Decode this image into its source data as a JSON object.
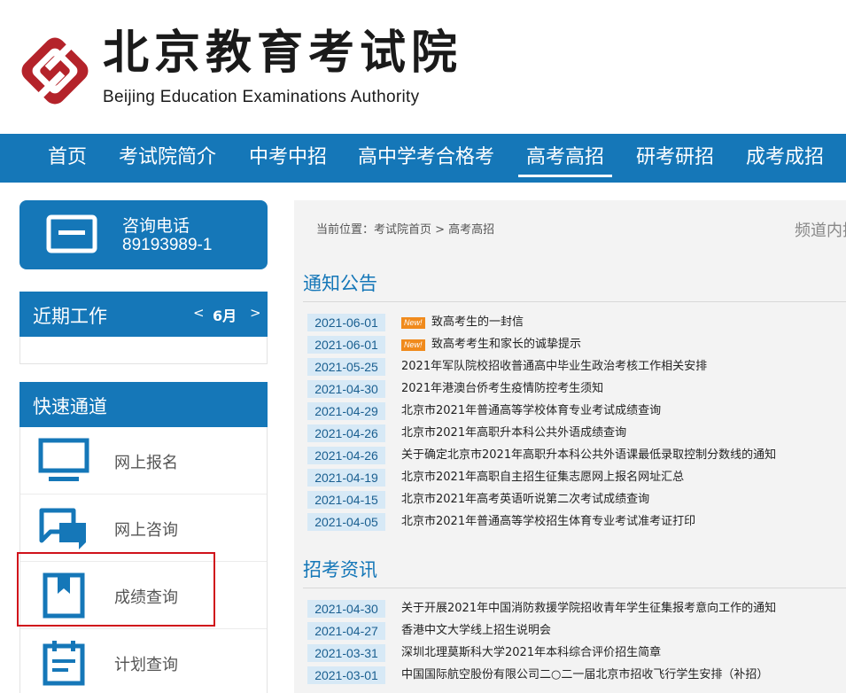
{
  "header": {
    "logo_cn": "北京教育考试院",
    "logo_en": "Beijing Education Examinations Authority",
    "colors": {
      "brand_red": "#b4232a",
      "nav_blue": "#1577b8"
    }
  },
  "nav": {
    "items": [
      {
        "label": "首页",
        "active": false
      },
      {
        "label": "考试院简介",
        "active": false
      },
      {
        "label": "中考中招",
        "active": false
      },
      {
        "label": "高中学考合格考",
        "active": false
      },
      {
        "label": "高考高招",
        "active": true
      },
      {
        "label": "研考研招",
        "active": false
      },
      {
        "label": "成考成招",
        "active": false
      }
    ]
  },
  "sidebar": {
    "phone": {
      "label": "咨询电话",
      "number": "89193989-1",
      "icon": "phone-card-icon"
    },
    "recent": {
      "title": "近期工作",
      "prev": "<",
      "month": "6月",
      "next": ">"
    },
    "quick": {
      "title": "快速通道",
      "items": [
        {
          "label": "网上报名",
          "icon": "monitor-icon"
        },
        {
          "label": "网上咨询",
          "icon": "chat-bubbles-icon"
        },
        {
          "label": "成绩查询",
          "icon": "bookmark-book-icon",
          "highlighted": true
        },
        {
          "label": "计划查询",
          "icon": "clipboard-icon"
        }
      ]
    }
  },
  "main": {
    "breadcrumb": "当前位置：考试院首页 > 高考高招",
    "channel_search": "频道内搜索",
    "notices": {
      "title": "通知公告",
      "items": [
        {
          "date": "2021-06-01",
          "new": "New!",
          "title": "致高考生的一封信"
        },
        {
          "date": "2021-06-01",
          "new": "New!",
          "title": "致高考考生和家长的诚挚提示"
        },
        {
          "date": "2021-05-25",
          "new": "",
          "title": "2021年军队院校招收普通高中毕业生政治考核工作相关安排"
        },
        {
          "date": "2021-04-30",
          "new": "",
          "title": "2021年港澳台侨考生疫情防控考生须知"
        },
        {
          "date": "2021-04-29",
          "new": "",
          "title": "北京市2021年普通高等学校体育专业考试成绩查询"
        },
        {
          "date": "2021-04-26",
          "new": "",
          "title": "北京市2021年高职升本科公共外语成绩查询"
        },
        {
          "date": "2021-04-26",
          "new": "",
          "title": "关于确定北京市2021年高职升本科公共外语课最低录取控制分数线的通知"
        },
        {
          "date": "2021-04-19",
          "new": "",
          "title": "北京市2021年高职自主招生征集志愿网上报名网址汇总"
        },
        {
          "date": "2021-04-15",
          "new": "",
          "title": "北京市2021年高考英语听说第二次考试成绩查询"
        },
        {
          "date": "2021-04-05",
          "new": "",
          "title": "北京市2021年普通高等学校招生体育专业考试准考证打印"
        }
      ]
    },
    "admissions": {
      "title": "招考资讯",
      "items": [
        {
          "date": "2021-04-30",
          "title": "关于开展2021年中国消防救援学院招收青年学生征集报考意向工作的通知"
        },
        {
          "date": "2021-04-27",
          "title": "香港中文大学线上招生说明会"
        },
        {
          "date": "2021-03-31",
          "title": "深圳北理莫斯科大学2021年本科综合评价招生简章"
        },
        {
          "date": "2021-03-01",
          "title": "中国国际航空股份有限公司二○二一届北京市招收飞行学生安排（补招）"
        }
      ]
    }
  }
}
